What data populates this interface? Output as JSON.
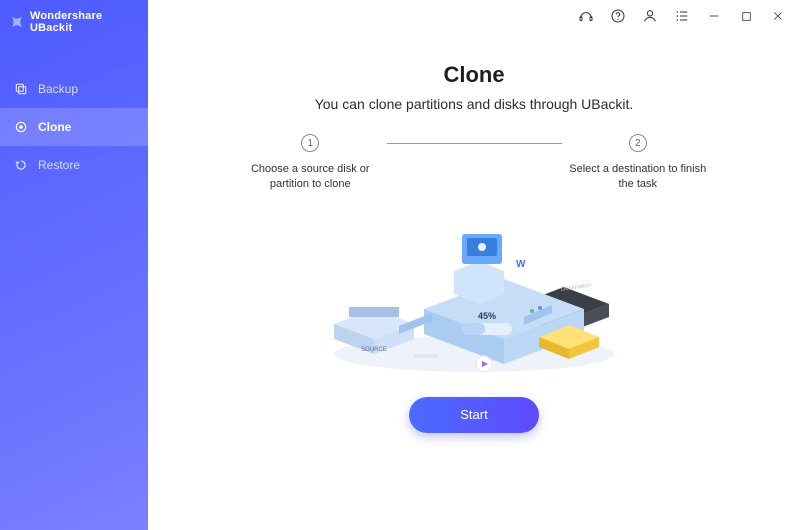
{
  "brand": {
    "name": "Wondershare UBackit"
  },
  "sidebar": {
    "items": [
      {
        "label": "Backup",
        "icon": "backup-icon",
        "active": false
      },
      {
        "label": "Clone",
        "icon": "clone-icon",
        "active": true
      },
      {
        "label": "Restore",
        "icon": "restore-icon",
        "active": false
      }
    ]
  },
  "titlebar": {
    "buttons": [
      "support-icon",
      "help-icon",
      "account-icon",
      "tasklist-icon",
      "minimize-icon",
      "maximize-icon",
      "close-icon"
    ]
  },
  "page": {
    "title": "Clone",
    "subtitle": "You can clone partitions and disks through UBackit.",
    "steps": [
      {
        "num": "1",
        "label": "Choose a source disk or partition to clone"
      },
      {
        "num": "2",
        "label": "Select a destination to finish the task"
      }
    ],
    "illustration": {
      "percent_label": "45%"
    },
    "start_label": "Start"
  }
}
